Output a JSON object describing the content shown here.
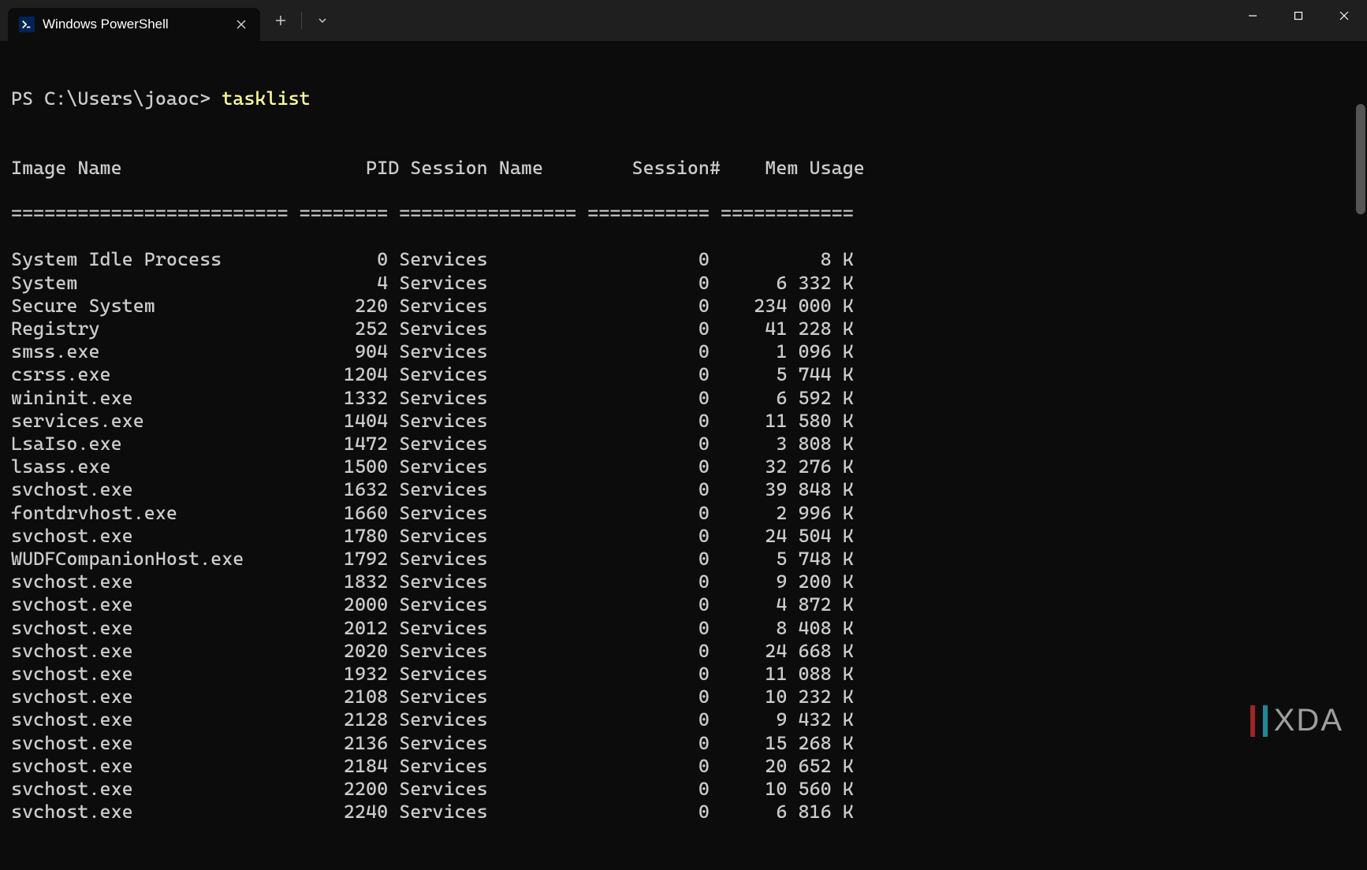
{
  "tab": {
    "title": "Windows PowerShell"
  },
  "prompt": {
    "ps": "PS C:\\Users\\joaoc> ",
    "command": "tasklist"
  },
  "columns": [
    "Image Name",
    "PID",
    "Session Name",
    "Session#",
    "Mem Usage"
  ],
  "widths": [
    25,
    8,
    16,
    11,
    12
  ],
  "header_line": "Image Name                      PID Session Name        Session#    Mem Usage",
  "separator_line": "========================= ======== ================ =========== ============",
  "rows": [
    {
      "image": "System Idle Process",
      "pid": 0,
      "sess": "Services",
      "snum": 0,
      "mem": "8 K"
    },
    {
      "image": "System",
      "pid": 4,
      "sess": "Services",
      "snum": 0,
      "mem": "6 332 K"
    },
    {
      "image": "Secure System",
      "pid": 220,
      "sess": "Services",
      "snum": 0,
      "mem": "234 000 K"
    },
    {
      "image": "Registry",
      "pid": 252,
      "sess": "Services",
      "snum": 0,
      "mem": "41 228 K"
    },
    {
      "image": "smss.exe",
      "pid": 904,
      "sess": "Services",
      "snum": 0,
      "mem": "1 096 K"
    },
    {
      "image": "csrss.exe",
      "pid": 1204,
      "sess": "Services",
      "snum": 0,
      "mem": "5 744 K"
    },
    {
      "image": "wininit.exe",
      "pid": 1332,
      "sess": "Services",
      "snum": 0,
      "mem": "6 592 K"
    },
    {
      "image": "services.exe",
      "pid": 1404,
      "sess": "Services",
      "snum": 0,
      "mem": "11 580 K"
    },
    {
      "image": "LsaIso.exe",
      "pid": 1472,
      "sess": "Services",
      "snum": 0,
      "mem": "3 808 K"
    },
    {
      "image": "lsass.exe",
      "pid": 1500,
      "sess": "Services",
      "snum": 0,
      "mem": "32 276 K"
    },
    {
      "image": "svchost.exe",
      "pid": 1632,
      "sess": "Services",
      "snum": 0,
      "mem": "39 848 K"
    },
    {
      "image": "fontdrvhost.exe",
      "pid": 1660,
      "sess": "Services",
      "snum": 0,
      "mem": "2 996 K"
    },
    {
      "image": "svchost.exe",
      "pid": 1780,
      "sess": "Services",
      "snum": 0,
      "mem": "24 504 K"
    },
    {
      "image": "WUDFCompanionHost.exe",
      "pid": 1792,
      "sess": "Services",
      "snum": 0,
      "mem": "5 748 K"
    },
    {
      "image": "svchost.exe",
      "pid": 1832,
      "sess": "Services",
      "snum": 0,
      "mem": "9 200 K"
    },
    {
      "image": "svchost.exe",
      "pid": 2000,
      "sess": "Services",
      "snum": 0,
      "mem": "4 872 K"
    },
    {
      "image": "svchost.exe",
      "pid": 2012,
      "sess": "Services",
      "snum": 0,
      "mem": "8 408 K"
    },
    {
      "image": "svchost.exe",
      "pid": 2020,
      "sess": "Services",
      "snum": 0,
      "mem": "24 668 K"
    },
    {
      "image": "svchost.exe",
      "pid": 1932,
      "sess": "Services",
      "snum": 0,
      "mem": "11 088 K"
    },
    {
      "image": "svchost.exe",
      "pid": 2108,
      "sess": "Services",
      "snum": 0,
      "mem": "10 232 K"
    },
    {
      "image": "svchost.exe",
      "pid": 2128,
      "sess": "Services",
      "snum": 0,
      "mem": "9 432 K"
    },
    {
      "image": "svchost.exe",
      "pid": 2136,
      "sess": "Services",
      "snum": 0,
      "mem": "15 268 K"
    },
    {
      "image": "svchost.exe",
      "pid": 2184,
      "sess": "Services",
      "snum": 0,
      "mem": "20 652 K"
    },
    {
      "image": "svchost.exe",
      "pid": 2200,
      "sess": "Services",
      "snum": 0,
      "mem": "10 560 K"
    },
    {
      "image": "svchost.exe",
      "pid": 2240,
      "sess": "Services",
      "snum": 0,
      "mem": "6 816 K"
    }
  ],
  "watermark": "XDA"
}
